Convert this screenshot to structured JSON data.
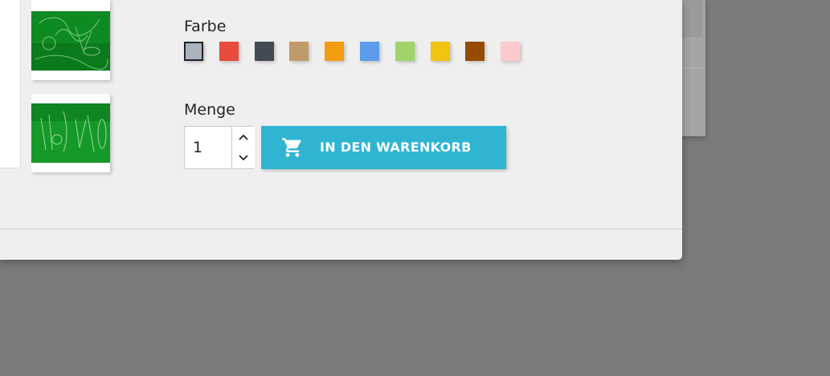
{
  "product": {
    "color_label": "Farbe",
    "quantity_label": "Menge",
    "quantity_value": "1",
    "add_to_cart_label": "In den Warenkorb",
    "swatches": [
      {
        "color": "#aab2bd",
        "selected": true
      },
      {
        "color": "#e84c3d",
        "selected": false
      },
      {
        "color": "#434a54",
        "selected": false
      },
      {
        "color": "#c19a6b",
        "selected": false
      },
      {
        "color": "#f39c11",
        "selected": false
      },
      {
        "color": "#5d9cec",
        "selected": false
      },
      {
        "color": "#a0d468",
        "selected": false
      },
      {
        "color": "#f1c40f",
        "selected": false
      },
      {
        "color": "#964b00",
        "selected": false
      },
      {
        "color": "#fccacd",
        "selected": false
      }
    ]
  },
  "icons": {
    "cart": "shopping-cart-icon",
    "qty_up": "chevron-up-icon",
    "qty_down": "chevron-down-icon"
  },
  "colors": {
    "accent": "#2fb5d2",
    "modal_bg": "#efefef",
    "overlay_bg": "#7a7a7a",
    "thumbnail_green": "#0e8a22"
  }
}
